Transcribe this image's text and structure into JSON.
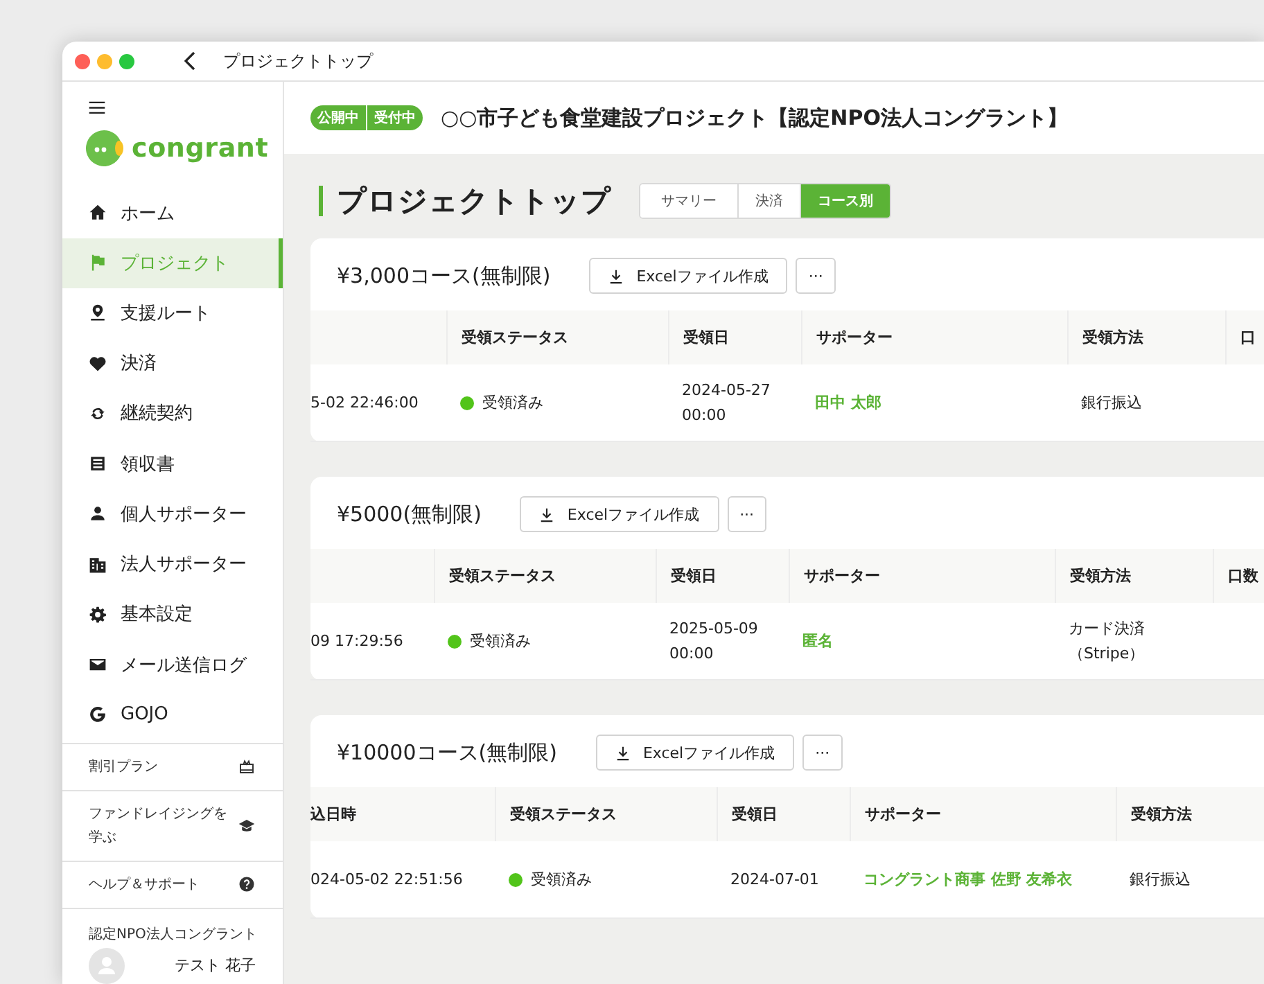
{
  "window": {
    "title": "プロジェクトトップ"
  },
  "sidebar": {
    "logo": "congrant",
    "items": [
      {
        "label": "ホーム",
        "kind": "home",
        "selected": false
      },
      {
        "label": "プロジェクト",
        "kind": "flag",
        "selected": true
      },
      {
        "label": "支援ルート",
        "kind": "pin",
        "selected": false
      },
      {
        "label": "決済",
        "kind": "heart",
        "selected": false
      },
      {
        "label": "継続契約",
        "kind": "cycle",
        "selected": false
      },
      {
        "label": "領収書",
        "kind": "receipt",
        "selected": false
      },
      {
        "label": "個人サポーター",
        "kind": "person",
        "selected": false
      },
      {
        "label": "法人サポーター",
        "kind": "building",
        "selected": false
      },
      {
        "label": "基本設定",
        "kind": "gear",
        "selected": false
      },
      {
        "label": "メール送信ログ",
        "kind": "mail",
        "selected": false
      },
      {
        "label": "GOJO",
        "kind": "g",
        "selected": false
      }
    ],
    "links": [
      {
        "label": "割引プラン",
        "kind": "gift"
      },
      {
        "label": "ファンドレイジングを学ぶ",
        "kind": "cap"
      },
      {
        "label": "ヘルプ＆サポート",
        "kind": "help"
      }
    ],
    "organization": "認定NPO法人コングラント",
    "user": "テスト 花子"
  },
  "header": {
    "badges": [
      "公開中",
      "受付中"
    ],
    "title": "○○市子ども食堂建設プロジェクト【認定NPO法人コングラント】"
  },
  "page_title": "プロジェクトトップ",
  "view_tabs": [
    {
      "label": "サマリー",
      "selected": false
    },
    {
      "label": "決済",
      "selected": false
    },
    {
      "label": "コース別",
      "selected": true
    }
  ],
  "courses": [
    {
      "title": "¥3,000コース(無制限)",
      "export_button": "Excelファイル作成",
      "more_button": "···",
      "columns": [
        "受領ステータス",
        "受領日",
        "サポーター",
        "受領方法",
        "口"
      ],
      "rows": [
        {
          "applied_at": "5-02 22:46:00",
          "status": "受領済み",
          "color": "#52c41a",
          "received_on": "2024-05-27 00:00",
          "supporter": "田中 太郎",
          "method": "銀行振込"
        }
      ]
    },
    {
      "title": "¥5000(無制限)",
      "export_button": "Excelファイル作成",
      "more_button": "···",
      "columns": [
        "受領ステータス",
        "受領日",
        "サポーター",
        "受領方法",
        "口数"
      ],
      "rows": [
        {
          "applied_at": "09 17:29:56",
          "status": "受領済み",
          "color": "#52c41a",
          "received_on": "2025-05-09 00:00",
          "supporter": "匿名",
          "method": "カード決済（Stripe）"
        }
      ]
    },
    {
      "title": "¥10000コース(無制限)",
      "export_button": "Excelファイル作成",
      "more_button": "···",
      "leading_column": "込日時",
      "columns": [
        "受領ステータス",
        "受領日",
        "サポーター",
        "受領方法"
      ],
      "rows": [
        {
          "applied_at": "024-05-02 22:51:56",
          "status": "受領済み",
          "color": "#52c41a",
          "received_on": "2024-07-01",
          "supporter": "コングラント商事 佐野 友希衣",
          "method": "銀行振込"
        }
      ]
    }
  ]
}
